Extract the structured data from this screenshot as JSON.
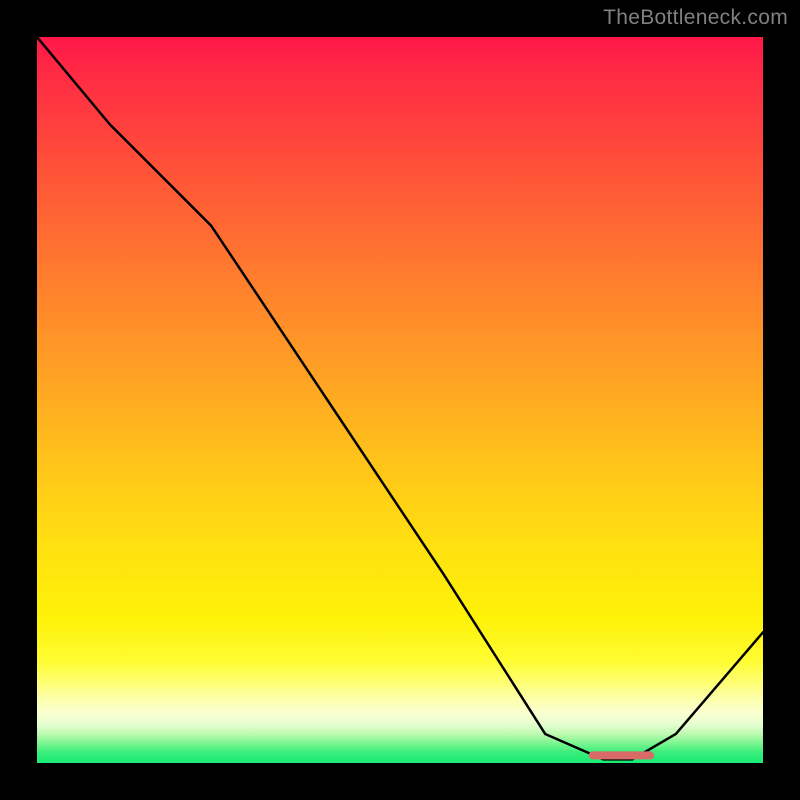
{
  "watermark": "TheBottleneck.com",
  "chart_data": {
    "type": "line",
    "title": "",
    "xlabel": "",
    "ylabel": "",
    "xlim": [
      0,
      100
    ],
    "ylim": [
      0,
      100
    ],
    "series": [
      {
        "name": "bottleneck-curve",
        "x": [
          0,
          10,
          24,
          40,
          56,
          70,
          78,
          82,
          88,
          100
        ],
        "y": [
          100,
          88,
          74,
          50,
          26,
          4,
          0.5,
          0.5,
          4,
          18
        ]
      }
    ],
    "marker": {
      "name": "optimal-range",
      "x_start": 76,
      "x_end": 85,
      "y": 0.5
    },
    "background_gradient": [
      {
        "pos": 0,
        "color": "#ff1748"
      },
      {
        "pos": 4,
        "color": "#ff2745"
      },
      {
        "pos": 18,
        "color": "#ff5138"
      },
      {
        "pos": 32,
        "color": "#ff7a2e"
      },
      {
        "pos": 46,
        "color": "#ffa024"
      },
      {
        "pos": 58,
        "color": "#ffc21a"
      },
      {
        "pos": 70,
        "color": "#ffe010"
      },
      {
        "pos": 80,
        "color": "#fef207"
      },
      {
        "pos": 86,
        "color": "#fffc33"
      },
      {
        "pos": 89.2,
        "color": "#feff7a"
      },
      {
        "pos": 91,
        "color": "#fdffa8"
      },
      {
        "pos": 93,
        "color": "#fbffcf"
      },
      {
        "pos": 94.6,
        "color": "#e8fed2"
      },
      {
        "pos": 96,
        "color": "#bdfbb0"
      },
      {
        "pos": 97.3,
        "color": "#7af58f"
      },
      {
        "pos": 98.5,
        "color": "#3aee7b"
      },
      {
        "pos": 100,
        "color": "#17eb74"
      }
    ]
  }
}
